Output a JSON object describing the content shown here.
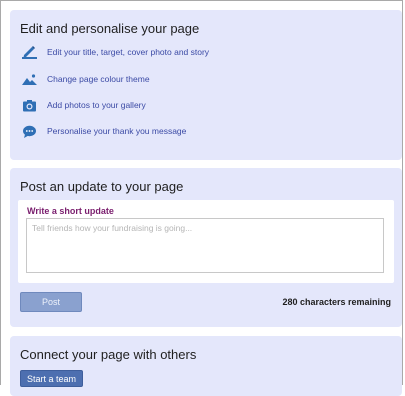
{
  "edit_panel": {
    "title": "Edit and personalise your page",
    "items": [
      {
        "label": "Edit your title, target, cover photo and story",
        "icon": "pencil-icon"
      },
      {
        "label": "Change page colour theme",
        "icon": "landscape-icon"
      },
      {
        "label": "Add photos to your gallery",
        "icon": "camera-icon"
      },
      {
        "label": "Personalise your thank you message",
        "icon": "speech-bubble-icon"
      }
    ]
  },
  "update_panel": {
    "title": "Post an update to your page",
    "field_label": "Write a short update",
    "placeholder": "Tell friends how your fundraising is going...",
    "value": "",
    "post_label": "Post",
    "chars_remaining": "280 characters remaining"
  },
  "connect_panel": {
    "title": "Connect your page with others",
    "team_button_label": "Start a team"
  },
  "colors": {
    "panel_background": "#e4e7fb",
    "link": "#3b4aa5",
    "icon_blue": "#2f6fb5",
    "update_label": "#7a1e6e",
    "post_button": "#8aa1cf",
    "team_button": "#4d6fb0"
  }
}
